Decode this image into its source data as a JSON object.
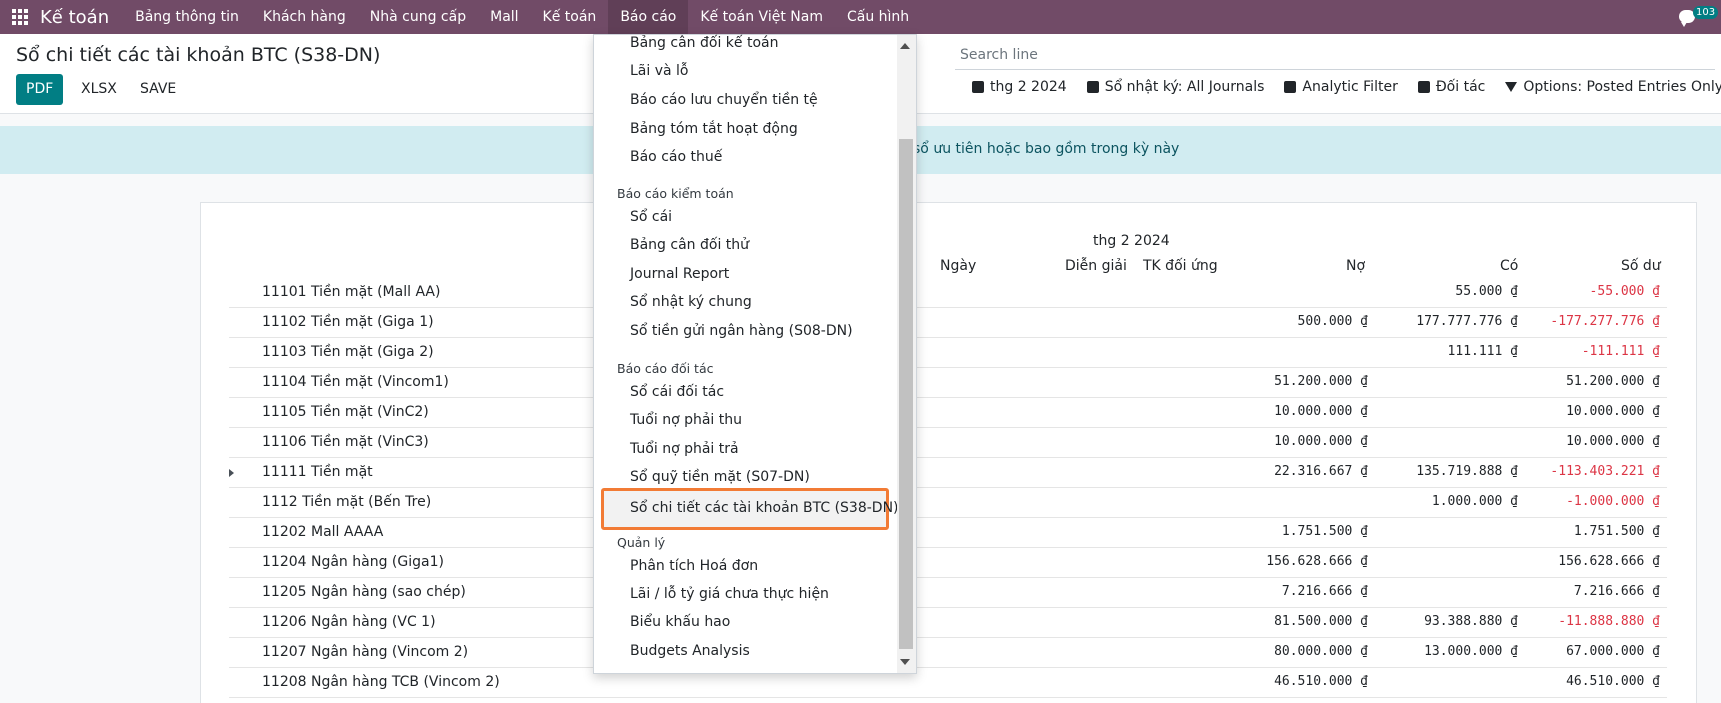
{
  "nav": {
    "app_title": "Kế toán",
    "items": [
      "Bảng thông tin",
      "Khách hàng",
      "Nhà cung cấp",
      "Mall",
      "Kế toán",
      "Báo cáo",
      "Kế toán Việt Nam",
      "Cấu hình"
    ],
    "active_item": "Báo cáo",
    "chat_count": "103",
    "apps_icon": "apps-grid-icon",
    "chat_icon": "chat-icon"
  },
  "control": {
    "title": "Sổ chi tiết các tài khoản BTC (S38-DN)",
    "buttons": {
      "pdf": "PDF",
      "xlsx": "XLSX",
      "save": "SAVE"
    },
    "search_placeholder": "Search line",
    "filters": {
      "date": "thg 2 2024",
      "journals": "Sổ nhật ký: All Journals",
      "analytic": "Analytic Filter",
      "partner": "Đối tác",
      "options": "Options: Posted Entries Only"
    },
    "primary_color": "#017e84"
  },
  "info_text": "o sổ ưu tiên hoặc bao gồm trong kỳ này",
  "report": {
    "period": "thg 2 2024",
    "columns": {
      "date": "Ngày",
      "desc": "Diễn giải",
      "contra": "TK đối ứng",
      "debit": "Nợ",
      "credit": "Có",
      "balance": "Số dư"
    },
    "rows": [
      {
        "label": "11101 Tiền mặt (Mall AA)",
        "debit": "",
        "credit": "55.000 ₫",
        "balance": "-55.000 ₫"
      },
      {
        "label": "11102 Tiền mặt (Giga 1)",
        "debit": "500.000 ₫",
        "credit": "177.777.776 ₫",
        "balance": "-177.277.776 ₫"
      },
      {
        "label": "11103 Tiền mặt (Giga 2)",
        "debit": "",
        "credit": "111.111 ₫",
        "balance": "-111.111 ₫"
      },
      {
        "label": "11104 Tiền mặt (Vincom1)",
        "debit": "51.200.000 ₫",
        "credit": "",
        "balance": "51.200.000 ₫"
      },
      {
        "label": "11105 Tiền mặt (VinC2)",
        "debit": "10.000.000 ₫",
        "credit": "",
        "balance": "10.000.000 ₫"
      },
      {
        "label": "11106 Tiền mặt (VinC3)",
        "debit": "10.000.000 ₫",
        "credit": "",
        "balance": "10.000.000 ₫"
      },
      {
        "label": "11111 Tiền mặt",
        "debit": "22.316.667 ₫",
        "credit": "135.719.888 ₫",
        "balance": "-113.403.221 ₫",
        "expandable": true
      },
      {
        "label": "1112 Tiền mặt (Bến Tre)",
        "debit": "",
        "credit": "1.000.000 ₫",
        "balance": "-1.000.000 ₫"
      },
      {
        "label": "11202 Mall AAAA",
        "debit": "1.751.500 ₫",
        "credit": "",
        "balance": "1.751.500 ₫"
      },
      {
        "label": "11204 Ngân hàng (Giga1)",
        "debit": "156.628.666 ₫",
        "credit": "",
        "balance": "156.628.666 ₫"
      },
      {
        "label": "11205 Ngân hàng (sao chép)",
        "debit": "7.216.666 ₫",
        "credit": "",
        "balance": "7.216.666 ₫"
      },
      {
        "label": "11206 Ngân hàng (VC 1)",
        "debit": "81.500.000 ₫",
        "credit": "93.388.880 ₫",
        "balance": "-11.888.880 ₫"
      },
      {
        "label": "11207 Ngân hàng (Vincom 2)",
        "debit": "80.000.000 ₫",
        "credit": "13.000.000 ₫",
        "balance": "67.000.000 ₫"
      },
      {
        "label": "11208 Ngân hàng TCB (Vincom 2)",
        "debit": "46.510.000 ₫",
        "credit": "",
        "balance": "46.510.000 ₫"
      }
    ],
    "negative_color": "#dc3545"
  },
  "dropdown": {
    "top_items": [
      "Bảng cân đối kế toán",
      "Lãi và lỗ",
      "Báo cáo lưu chuyển tiền tệ",
      "Bảng tóm tắt hoạt động",
      "Báo cáo thuế"
    ],
    "audit_header": "Báo cáo kiểm toán",
    "audit_items": [
      "Sổ cái",
      "Bảng cân đối thử",
      "Journal Report",
      "Sổ nhật ký chung",
      "Sổ tiền gửi ngân hàng (S08-DN)"
    ],
    "partner_header": "Báo cáo đối tác",
    "partner_items": [
      "Sổ cái đối tác",
      "Tuổi nợ phải thu",
      "Tuổi nợ phải trả",
      "Sổ quỹ tiền mặt (S07-DN)",
      "Sổ chi tiết các tài khoản BTC (S38-DN)"
    ],
    "manage_header": "Quản lý",
    "manage_items": [
      "Phân tích Hoá đơn",
      "Lãi / lỗ tỷ giá chưa thực hiện",
      "Biểu khấu hao",
      "Budgets Analysis"
    ],
    "highlight_color": "#f27b35"
  }
}
